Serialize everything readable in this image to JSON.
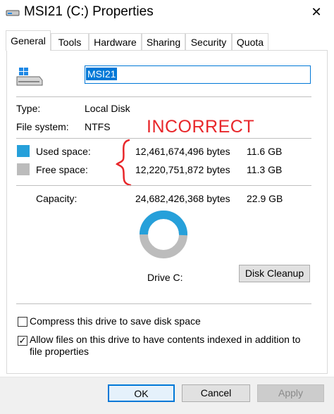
{
  "window": {
    "title": "MSI21 (C:) Properties",
    "close_glyph": "✕"
  },
  "tabs": [
    {
      "label": "General",
      "active": true
    },
    {
      "label": "Tools"
    },
    {
      "label": "Hardware"
    },
    {
      "label": "Sharing"
    },
    {
      "label": "Security"
    },
    {
      "label": "Quota"
    }
  ],
  "general": {
    "drive_name": "MSI21",
    "type_label": "Type:",
    "type_value": "Local Disk",
    "fs_label": "File system:",
    "fs_value": "NTFS",
    "annotation": "INCORRECT",
    "annotation_color": "#e8262a",
    "used": {
      "label": "Used space:",
      "bytes": "12,461,674,496 bytes",
      "size": "11.6 GB",
      "color": "#26a0da",
      "fraction": 0.505
    },
    "free": {
      "label": "Free space:",
      "bytes": "12,220,751,872 bytes",
      "size": "11.3 GB",
      "color": "#bcbcbc"
    },
    "capacity": {
      "label": "Capacity:",
      "bytes": "24,682,426,368 bytes",
      "size": "22.9 GB"
    },
    "drive_label": "Drive C:",
    "cleanup_button": "Disk Cleanup",
    "compress_label": "Compress this drive to save disk space",
    "compress_checked": false,
    "index_label": "Allow files on this drive to have contents indexed in addition to file properties",
    "index_checked": true
  },
  "footer": {
    "ok": "OK",
    "cancel": "Cancel",
    "apply": "Apply"
  }
}
